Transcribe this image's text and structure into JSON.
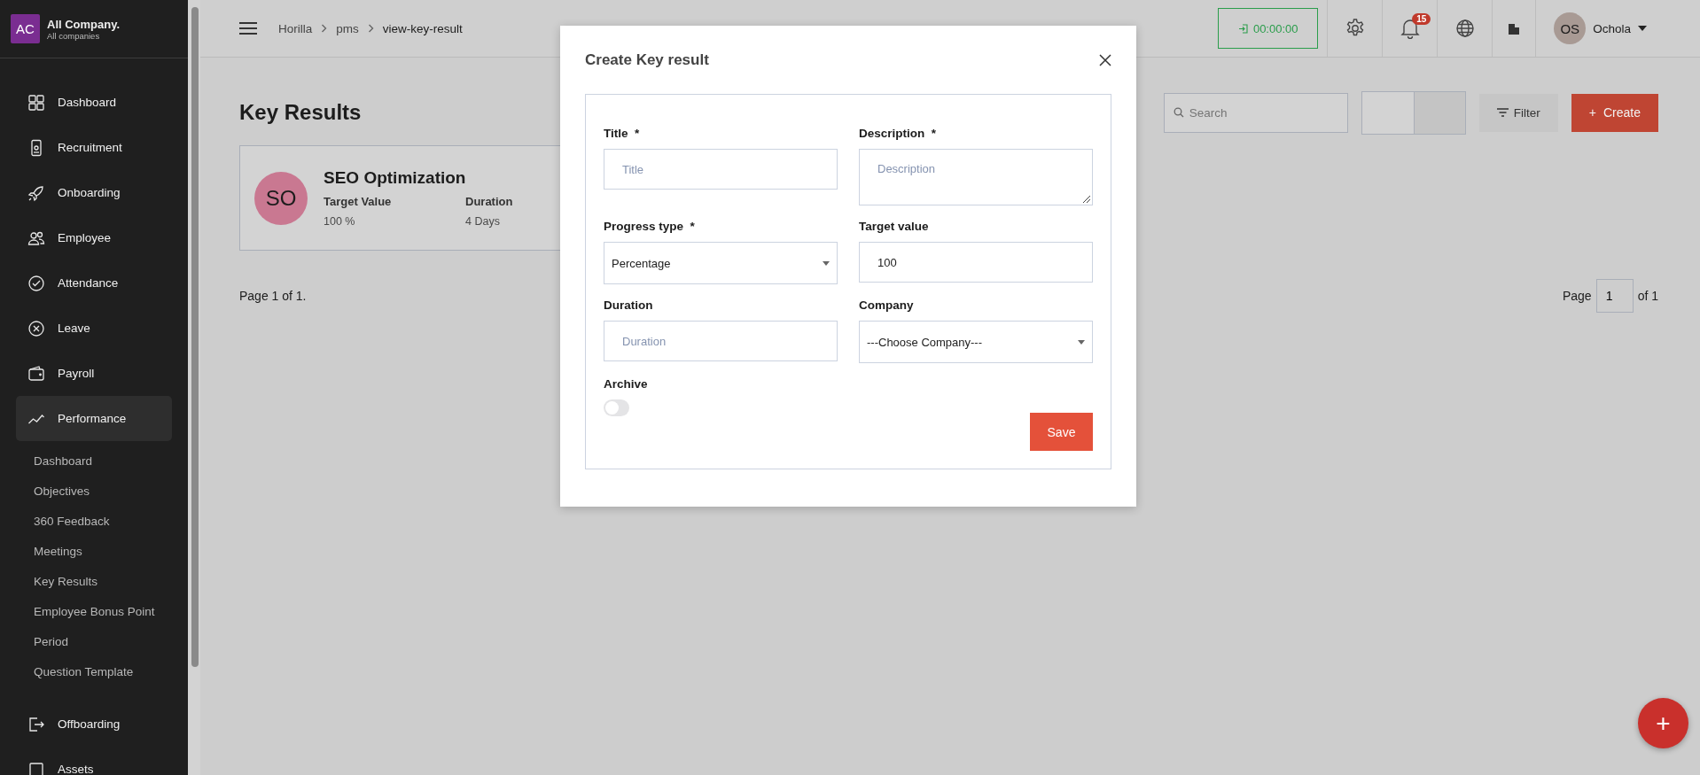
{
  "sidebar": {
    "company": {
      "initials": "AC",
      "name": "All Company.",
      "subtitle": "All companies"
    },
    "items": [
      {
        "label": "Dashboard",
        "selected": false
      },
      {
        "label": "Recruitment",
        "selected": false
      },
      {
        "label": "Onboarding",
        "selected": false
      },
      {
        "label": "Employee",
        "selected": false
      },
      {
        "label": "Attendance",
        "selected": false
      },
      {
        "label": "Leave",
        "selected": false
      },
      {
        "label": "Payroll",
        "selected": false
      },
      {
        "label": "Performance",
        "selected": true,
        "children": [
          {
            "label": "Dashboard",
            "selected": false
          },
          {
            "label": "Objectives",
            "selected": false
          },
          {
            "label": "360 Feedback",
            "selected": false
          },
          {
            "label": "Meetings",
            "selected": false
          },
          {
            "label": "Key Results",
            "selected": false
          },
          {
            "label": "Employee Bonus Point",
            "selected": false
          },
          {
            "label": "Period",
            "selected": false
          },
          {
            "label": "Question Template",
            "selected": false
          }
        ]
      },
      {
        "label": "Offboarding",
        "selected": false
      },
      {
        "label": "Assets",
        "selected": false
      }
    ]
  },
  "header": {
    "breadcrumb": [
      "Horilla",
      "pms",
      "view-key-result"
    ],
    "timer": "00:00:00",
    "notification_count": "15",
    "user": {
      "initials": "OS",
      "name": "Ochola"
    }
  },
  "page": {
    "title": "Key Results",
    "search": {
      "placeholder": "Search"
    },
    "filter": "Filter",
    "create": {
      "icon": "+",
      "label": "Create"
    },
    "card": {
      "initials": "SO",
      "title": "SEO Optimization",
      "fields": [
        {
          "label": "Target Value",
          "value": "100 %"
        },
        {
          "label": "Duration",
          "value": "4 Days"
        }
      ]
    },
    "page_info": "Page 1 of 1.",
    "pagination": {
      "label": "Page",
      "value": "1",
      "total": "of 1"
    },
    "fab": "+"
  },
  "modal": {
    "title": "Create Key result",
    "fields": [
      {
        "kind": "text",
        "label": "Title",
        "required_mark": "*",
        "placeholder": "Title"
      },
      {
        "kind": "textarea",
        "label": "Description",
        "required_mark": "*",
        "placeholder": "Description"
      },
      {
        "kind": "select",
        "label": "Progress type",
        "required_mark": "*",
        "value": "Percentage"
      },
      {
        "kind": "text",
        "label": "Target value",
        "value": "100"
      },
      {
        "kind": "text",
        "label": "Duration",
        "placeholder": "Duration"
      },
      {
        "kind": "select",
        "label": "Company",
        "value": "---Choose Company---"
      },
      {
        "kind": "toggle",
        "label": "Archive",
        "on": false
      }
    ],
    "save": "Save"
  }
}
